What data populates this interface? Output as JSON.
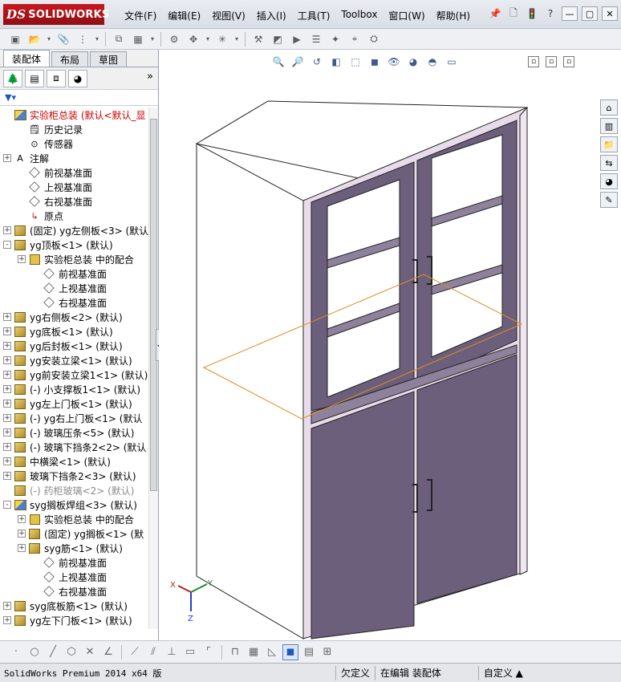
{
  "app": {
    "brand": "SOLIDWORKS",
    "brand_prefix": "DS"
  },
  "menu": {
    "items": [
      "文件(F)",
      "编辑(E)",
      "视图(V)",
      "插入(I)",
      "工具(T)",
      "Toolbox",
      "窗口(W)",
      "帮助(H)"
    ]
  },
  "fm": {
    "tabs": [
      "装配体",
      "布局",
      "草图"
    ],
    "active_tab": "装配体",
    "tree": [
      {
        "label": "实验柜总装   (默认<默认_显",
        "icon": "asm",
        "indent": 0,
        "exp": "",
        "cls": "red"
      },
      {
        "label": "历史记录",
        "icon": "history",
        "indent": 1,
        "exp": ""
      },
      {
        "label": "传感器",
        "icon": "sensor",
        "indent": 1,
        "exp": ""
      },
      {
        "label": "注解",
        "icon": "annotation",
        "indent": 0,
        "exp": "+"
      },
      {
        "label": "前视基准面",
        "icon": "plane",
        "indent": 1,
        "exp": ""
      },
      {
        "label": "上视基准面",
        "icon": "plane",
        "indent": 1,
        "exp": ""
      },
      {
        "label": "右视基准面",
        "icon": "plane",
        "indent": 1,
        "exp": ""
      },
      {
        "label": "原点",
        "icon": "origin",
        "indent": 1,
        "exp": ""
      },
      {
        "label": "(固定) yg左侧板<3> (默认",
        "icon": "part",
        "indent": 0,
        "exp": "+"
      },
      {
        "label": "yg顶板<1> (默认)",
        "icon": "part",
        "indent": 0,
        "exp": "-"
      },
      {
        "label": "实验柜总装 中的配合",
        "icon": "mate",
        "indent": 1,
        "exp": "+"
      },
      {
        "label": "前视基准面",
        "icon": "plane",
        "indent": 2,
        "exp": ""
      },
      {
        "label": "上视基准面",
        "icon": "plane",
        "indent": 2,
        "exp": ""
      },
      {
        "label": "右视基准面",
        "icon": "plane",
        "indent": 2,
        "exp": ""
      },
      {
        "label": "yg右侧板<2> (默认)",
        "icon": "part",
        "indent": 0,
        "exp": "+"
      },
      {
        "label": "yg底板<1> (默认)",
        "icon": "part",
        "indent": 0,
        "exp": "+"
      },
      {
        "label": "yg后封板<1> (默认)",
        "icon": "part",
        "indent": 0,
        "exp": "+"
      },
      {
        "label": "yg安装立梁<1> (默认)",
        "icon": "part",
        "indent": 0,
        "exp": "+"
      },
      {
        "label": "yg前安装立梁1<1> (默认)",
        "icon": "part",
        "indent": 0,
        "exp": "+"
      },
      {
        "label": "(-) 小支撑板1<1> (默认)",
        "icon": "part",
        "indent": 0,
        "exp": "+"
      },
      {
        "label": "yg左上门板<1> (默认)",
        "icon": "part",
        "indent": 0,
        "exp": "+"
      },
      {
        "label": "(-) yg右上门板<1> (默认",
        "icon": "part",
        "indent": 0,
        "exp": "+"
      },
      {
        "label": "(-) 玻璃压条<5> (默认)",
        "icon": "part",
        "indent": 0,
        "exp": "+"
      },
      {
        "label": "(-) 玻璃下挡条2<2> (默认",
        "icon": "part",
        "indent": 0,
        "exp": "+"
      },
      {
        "label": "中横梁<1> (默认)",
        "icon": "part",
        "indent": 0,
        "exp": "+"
      },
      {
        "label": "玻璃下挡条2<3> (默认)",
        "icon": "part",
        "indent": 0,
        "exp": "+"
      },
      {
        "label": "(-) 药柜玻璃<2> (默认)",
        "icon": "part",
        "indent": 0,
        "exp": "",
        "cls": "gray"
      },
      {
        "label": "syg搁板焊组<3> (默认)",
        "icon": "asm",
        "indent": 0,
        "exp": "-"
      },
      {
        "label": "实验柜总装 中的配合",
        "icon": "mate",
        "indent": 1,
        "exp": "+"
      },
      {
        "label": "(固定) yg搁板<1> (默",
        "icon": "part",
        "indent": 1,
        "exp": "+"
      },
      {
        "label": "syg筋<1> (默认)",
        "icon": "part",
        "indent": 1,
        "exp": "+"
      },
      {
        "label": "前视基准面",
        "icon": "plane",
        "indent": 2,
        "exp": ""
      },
      {
        "label": "上视基准面",
        "icon": "plane",
        "indent": 2,
        "exp": ""
      },
      {
        "label": "右视基准面",
        "icon": "plane",
        "indent": 2,
        "exp": ""
      },
      {
        "label": "syg底板筋<1> (默认)",
        "icon": "part",
        "indent": 0,
        "exp": "+"
      },
      {
        "label": "yg左下门板<1> (默认)",
        "icon": "part",
        "indent": 0,
        "exp": "+"
      }
    ]
  },
  "viewport": {
    "triad": {
      "x": "X",
      "y": "Y",
      "z": "Z"
    }
  },
  "status": {
    "app_text": "SolidWorks Premium 2014 x64 版",
    "cells": [
      "欠定义",
      "在编辑 装配体",
      "自定义 ▲"
    ]
  },
  "colors": {
    "door_fill": "#6b5f7c",
    "frame_fill": "#e9dcea",
    "body_fill": "#ffffff",
    "plane_stroke": "#e38a24"
  }
}
